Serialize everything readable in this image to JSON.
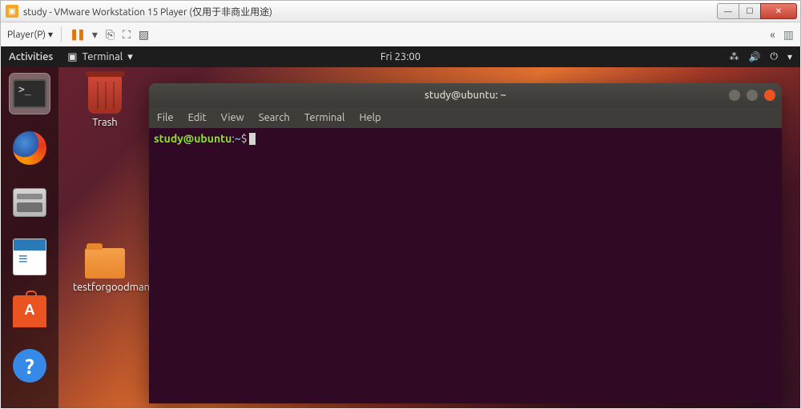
{
  "windows_titlebar": {
    "title": "study - VMware Workstation 15 Player (仅用于非商业用途)"
  },
  "vmware_toolbar": {
    "player_menu": "Player(P)",
    "dropdown_arrow": "▾"
  },
  "ubuntu_panel": {
    "activities": "Activities",
    "app_indicator": "Terminal",
    "app_indicator_arrow": "▾",
    "clock": "Fri 23:00",
    "tray_arrow": "▾"
  },
  "ubuntu_dock": {
    "items": [
      "terminal",
      "firefox",
      "files",
      "libreoffice-writer",
      "ubuntu-software",
      "help"
    ]
  },
  "desktop_icons": {
    "trash": "Trash",
    "folder1": "testforgoodman"
  },
  "terminal_window": {
    "title": "study@ubuntu: ~",
    "menubar": [
      "File",
      "Edit",
      "View",
      "Search",
      "Terminal",
      "Help"
    ],
    "prompt": {
      "user_host": "study@ubuntu",
      "sep": ":",
      "path": "~",
      "symbol": "$"
    }
  }
}
